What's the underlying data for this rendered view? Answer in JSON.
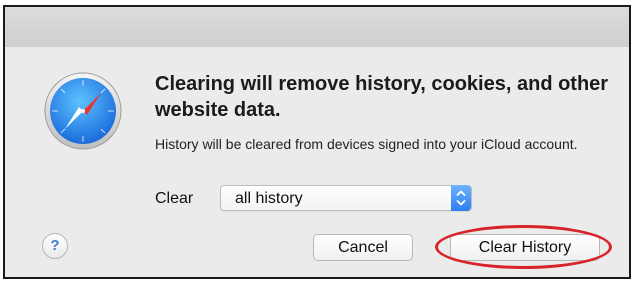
{
  "dialog": {
    "headline": "Clearing will remove history, cookies, and other website data.",
    "subtext": "History will be cleared from devices signed into your iCloud account.",
    "clear_label": "Clear",
    "clear_select": {
      "selected": "all history"
    },
    "help_label": "?",
    "cancel_label": "Cancel",
    "clear_history_label": "Clear History"
  },
  "icons": {
    "app_icon": "safari-compass-icon",
    "select_arrows": "chevron-up-down-icon"
  },
  "colors": {
    "accent": "#2b7ff0",
    "annotation": "#d8232a"
  }
}
